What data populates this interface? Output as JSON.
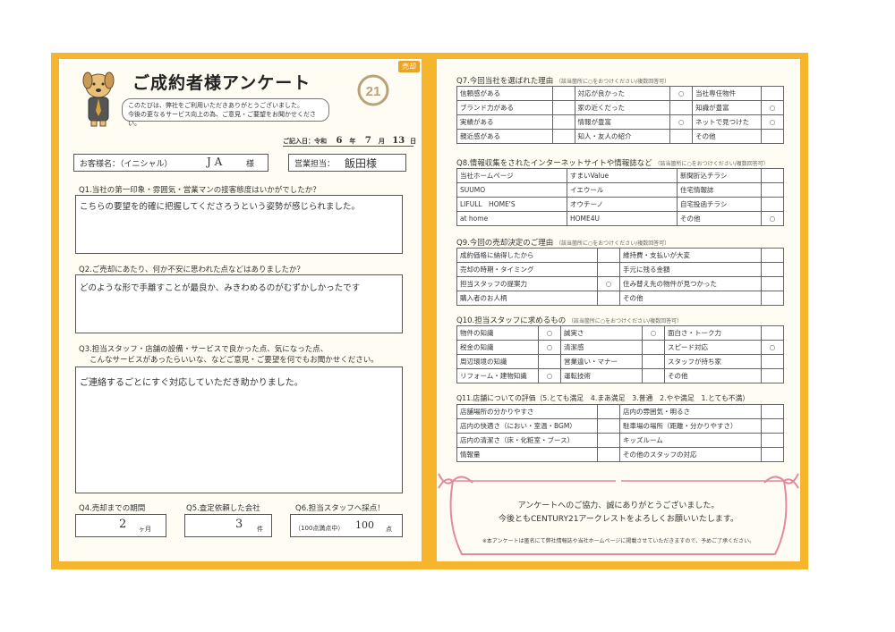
{
  "left": {
    "tag": "売却",
    "title": "ご成約者様アンケート",
    "intro_line1": "このたびは、弊社をご利用いただきありがとうございました。",
    "intro_line2": "今後の更なるサービス向上の為、ご意見・ご要望をお聞かせください。",
    "date_label": "ご記入日：令和",
    "date_year": "6",
    "date_year_unit": "年",
    "date_month": "7",
    "date_month_unit": "月",
    "date_day": "13",
    "date_day_unit": "日",
    "customer_label": "お客様名：（イニシャル）",
    "customer_value": "J A",
    "customer_suffix": "様",
    "staff_label": "営業担当：",
    "staff_value": "飯田様",
    "q1": "Q1.当社の第一印象・雰囲気・営業マンの接客態度はいかがでしたか？",
    "a1": "こちらの要望を的確に把握してくださろうという姿勢が感じられました。",
    "q2": "Q2.ご売却にあたり、何か不安に思われた点などはありましたか？",
    "a2": "どのような形で手離すことが最良か、みきわめるのがむずかしかったです",
    "q3_line1": "Q3.担当スタッフ・店舗の設備・サービスで良かった点、気になった点、",
    "q3_line2": "こんなサービスがあったらいいな、などご意見・ご要望を何でもお聞かせください。",
    "a3": "ご連絡するごとにすぐ対応していただき助かりました。",
    "q4": "Q4.売却までの期間",
    "a4": "2",
    "a4_unit": "ヶ月",
    "q5": "Q5.査定依頼した会社",
    "a5": "3",
    "a5_unit": "件",
    "q6": "Q6.担当スタッフへ採点！",
    "a6_label": "（100点満点中）",
    "a6": "100",
    "a6_unit": "点"
  },
  "right": {
    "q7": "Q7.今回当社を選ばれた理由",
    "q7_note": "（該当箇所に○をおつけください/複数回答可）",
    "q7_rows": [
      [
        "信頼感がある",
        "",
        "対応が良かった",
        "○",
        "当社専任物件",
        ""
      ],
      [
        "ブランド力がある",
        "",
        "家の近くだった",
        "",
        "知識が豊富",
        "○"
      ],
      [
        "実績がある",
        "",
        "情報が豊富",
        "○",
        "ネットで見つけた",
        "○"
      ],
      [
        "親近感がある",
        "",
        "知人・友人の紹介",
        "",
        "その他",
        ""
      ]
    ],
    "q8": "Q8.情報収集をされたインターネットサイトや情報誌など",
    "q8_note": "（該当箇所に○をおつけください/複数回答可）",
    "q8_rows": [
      [
        "当社ホームページ",
        "すまいValue",
        "新聞折込チラシ",
        ""
      ],
      [
        "SUUMO",
        "イエウール",
        "住宅情報誌",
        ""
      ],
      [
        "LIFULL　HOME'S",
        "オウチーノ",
        "自宅投函チラシ",
        ""
      ],
      [
        "at home",
        "HOME4U",
        "その他",
        "○"
      ]
    ],
    "q9": "Q9.今回の売却決定のご理由",
    "q9_note": "（該当箇所に○をおつけください/複数回答可）",
    "q9_rows": [
      [
        "成約価格に納得したから",
        "",
        "維持費・支払いが大変",
        ""
      ],
      [
        "売却の時期・タイミング",
        "",
        "手元に残る金額",
        ""
      ],
      [
        "担当スタッフの提案力",
        "○",
        "住み替え先の物件が見つかった",
        ""
      ],
      [
        "購入者のお人柄",
        "",
        "その他",
        ""
      ]
    ],
    "q10": "Q10.担当スタッフに求めるもの",
    "q10_note": "（該当箇所に○をおつけください/複数回答可）",
    "q10_rows": [
      [
        "物件の知識",
        "○",
        "誠実さ",
        "○",
        "面白さ・トーク力",
        ""
      ],
      [
        "税金の知識",
        "○",
        "清潔感",
        "",
        "スピード対応",
        "○"
      ],
      [
        "周辺環境の知識",
        "",
        "営業違い・マナー",
        "",
        "スタッフが持ち家",
        ""
      ],
      [
        "リフォーム・建物知識",
        "○",
        "運転技術",
        "",
        "その他",
        ""
      ]
    ],
    "q11": "Q11.店舗についての評価（5.とても満足　4.まあ満足　3.普通　2.やや満足　1.とても不満）",
    "q11_rows": [
      [
        "店舗場所の分かりやすさ",
        "",
        "店内の雰囲気・明るさ",
        ""
      ],
      [
        "店内の快適さ（におい・室温・BGM）",
        "",
        "駐車場の場所（距離・分かりやすさ）",
        ""
      ],
      [
        "店内の清潔さ（床・化粧室・ブース）",
        "",
        "キッズルーム",
        ""
      ],
      [
        "情報量",
        "",
        "その他のスタッフの対応",
        ""
      ]
    ],
    "thanks1": "アンケートへのご協力、誠にありがとうございました。",
    "thanks2": "今後ともCENTURY21アークレストをよろしくお願いいたします。",
    "footnote": "※本アンケートは匿名にて弊社情報誌や当社ホームページに掲載させていただきますので、予めご了承ください。"
  },
  "logo_text": "21",
  "colors": {
    "frame": "#f5b52d",
    "paper": "#fffdf3",
    "ribbon": "#e08a9a",
    "logo": "#b8a27a"
  }
}
